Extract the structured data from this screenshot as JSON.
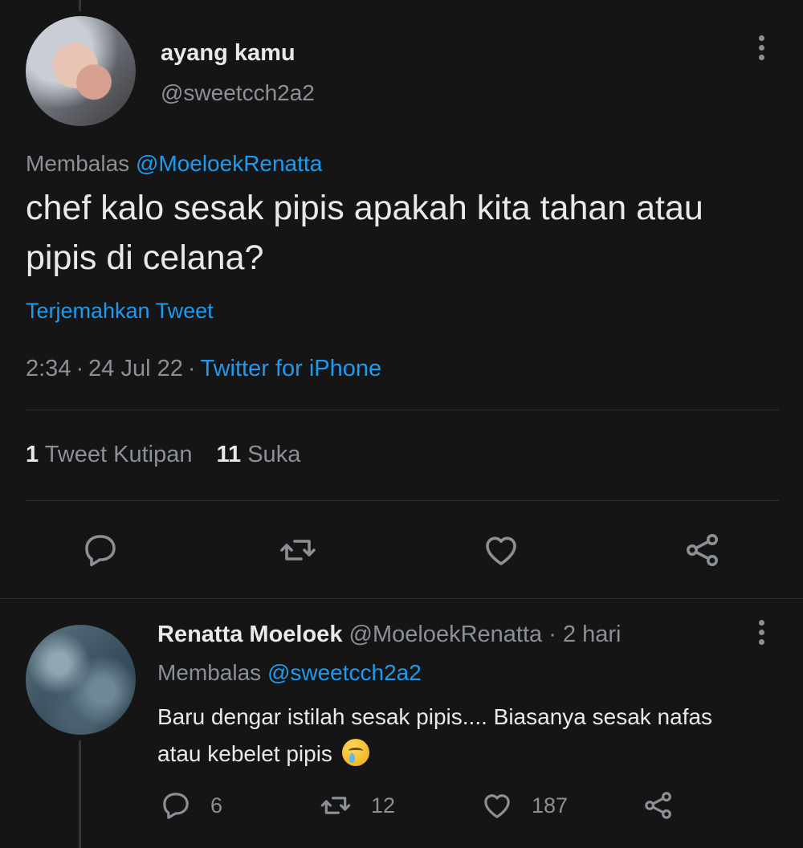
{
  "tweet": {
    "display_name": "ayang kamu",
    "handle": "@sweetcch2a2",
    "replying_prefix": "Membalas ",
    "replying_to": "@MoeloekRenatta",
    "text": "chef kalo sesak pipis apakah kita tahan atau pipis di celana?",
    "translate": "Terjemahkan Tweet",
    "time": "2:34",
    "date": "24 Jul 22",
    "source": "Twitter for iPhone",
    "separator": "·",
    "quote_count": "1",
    "quote_label": "Tweet Kutipan",
    "like_count": "11",
    "like_label": "Suka"
  },
  "reply": {
    "display_name": "Renatta Moeloek",
    "handle": "@MoeloekRenatta",
    "time_ago": "2 hari",
    "separator": "·",
    "replying_prefix": "Membalas ",
    "replying_to": "@sweetcch2a2",
    "text": "Baru dengar istilah sesak pipis.... Biasanya sesak nafas atau kebelet pipis",
    "emoji": "face-with-tear-emoji",
    "reply_count": "6",
    "retweet_count": "12",
    "like_count": "187"
  },
  "icons": {
    "reply": "reply-icon",
    "retweet": "retweet-icon",
    "like": "heart-icon",
    "share": "share-icon",
    "more": "more-vertical-icon"
  },
  "colors": {
    "background": "#151515",
    "text": "#e7e9ea",
    "muted": "#8b9096",
    "link": "#1d9bf0",
    "divider": "#2c2f32"
  }
}
